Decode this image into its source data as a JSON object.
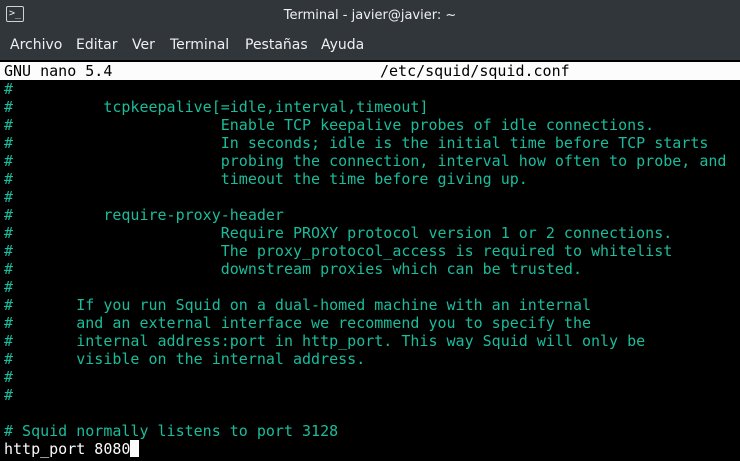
{
  "window": {
    "title": "Terminal - javier@javier: ~",
    "icon": "terminal-icon"
  },
  "menubar": {
    "items": [
      "Archivo",
      "Editar",
      "Ver",
      "Terminal",
      "Pestañas",
      "Ayuda"
    ]
  },
  "nano": {
    "version": "GNU nano 5.4",
    "filename": "/etc/squid/squid.conf"
  },
  "editor": {
    "lines": [
      "#",
      "#          tcpkeepalive[=idle,interval,timeout]",
      "#                       Enable TCP keepalive probes of idle connections.",
      "#                       In seconds; idle is the initial time before TCP starts",
      "#                       probing the connection, interval how often to probe, and",
      "#                       timeout the time before giving up.",
      "#",
      "#          require-proxy-header",
      "#                       Require PROXY protocol version 1 or 2 connections.",
      "#                       The proxy_protocol_access is required to whitelist",
      "#                       downstream proxies which can be trusted.",
      "#",
      "#       If you run Squid on a dual-homed machine with an internal",
      "#       and an external interface we recommend you to specify the",
      "#       internal address:port in http_port. This way Squid will only be",
      "#       visible on the internal address.",
      "#",
      "#",
      "",
      "# Squid normally listens to port 3128",
      "http_port 8080"
    ]
  },
  "colors": {
    "comment": "#1abc9c",
    "text": "#fcfcfc",
    "header_bg": "#fcfcfc",
    "chrome_bg": "#31363b"
  }
}
